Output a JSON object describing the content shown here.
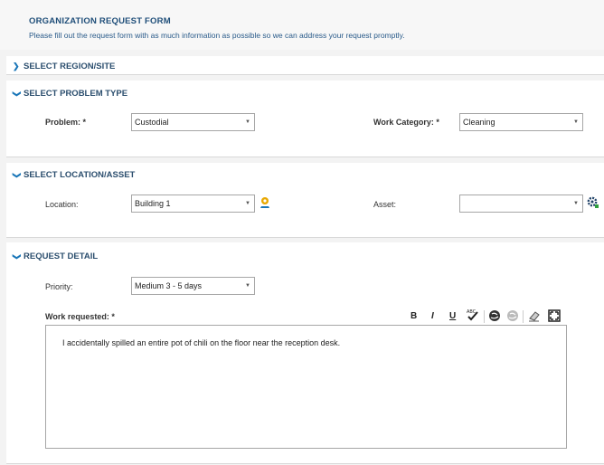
{
  "header": {
    "title": "ORGANIZATION REQUEST FORM",
    "subtitle": "Please fill out the request form with as much information as possible so we can address your request promptly."
  },
  "sections": {
    "region": {
      "title": "SELECT REGION/SITE",
      "chevron": ">"
    },
    "problem": {
      "title": "SELECT PROBLEM TYPE",
      "chevron": "v",
      "problem_label": "Problem: *",
      "problem_value": "Custodial",
      "category_label": "Work Category: *",
      "category_value": "Cleaning"
    },
    "location": {
      "title": "SELECT LOCATION/ASSET",
      "chevron": "v",
      "location_label": "Location:",
      "location_value": "Building 1",
      "asset_label": "Asset:",
      "asset_value": ""
    },
    "detail": {
      "title": "REQUEST DETAIL",
      "chevron": "v",
      "priority_label": "Priority:",
      "priority_value": "Medium 3 - 5 days",
      "work_label": "Work requested: *",
      "work_text": "I accidentally spilled an entire pot of chili on the floor near the reception desk."
    }
  },
  "toolbar": {
    "bold": "B",
    "italic": "I",
    "underline": "U"
  },
  "colors": {
    "accent": "#1a76b8",
    "heading": "#2b4e6e",
    "location_pin": "#e8a800",
    "asset_gear": "#1d6e2f"
  }
}
